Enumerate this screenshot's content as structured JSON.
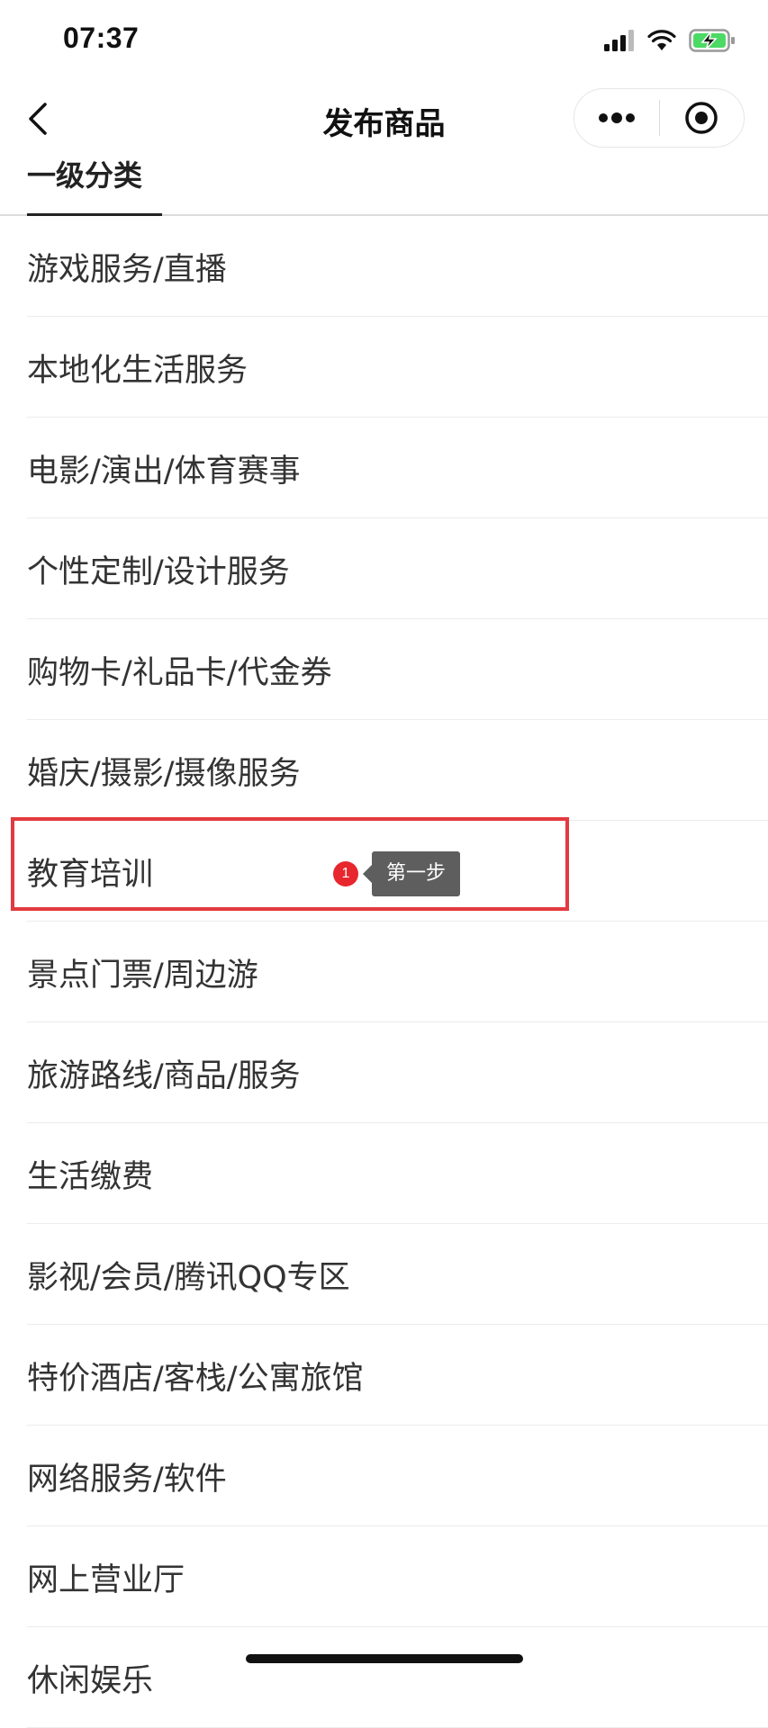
{
  "status_bar": {
    "time": "07:37"
  },
  "nav": {
    "title": "发布商品"
  },
  "tabs": [
    {
      "label": "一级分类"
    }
  ],
  "categories": [
    {
      "label": "游戏服务/直播"
    },
    {
      "label": "本地化生活服务"
    },
    {
      "label": "电影/演出/体育赛事"
    },
    {
      "label": "个性定制/设计服务"
    },
    {
      "label": "购物卡/礼品卡/代金券"
    },
    {
      "label": "婚庆/摄影/摄像服务"
    },
    {
      "label": "教育培训"
    },
    {
      "label": "景点门票/周边游"
    },
    {
      "label": "旅游路线/商品/服务"
    },
    {
      "label": "生活缴费"
    },
    {
      "label": "影视/会员/腾讯QQ专区"
    },
    {
      "label": "特价酒店/客栈/公寓旅馆"
    },
    {
      "label": "网络服务/软件"
    },
    {
      "label": "网上营业厅"
    },
    {
      "label": "休闲娱乐"
    }
  ],
  "annotation": {
    "badge": "1",
    "tip": "第一步"
  },
  "colors": {
    "highlight": "#e23a3f",
    "badge": "#e8262d",
    "battery": "#4cd964"
  }
}
